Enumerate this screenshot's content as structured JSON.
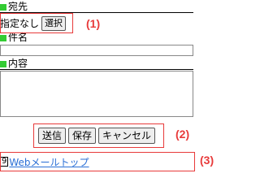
{
  "to_section": {
    "heading": "宛先",
    "value": "指定なし",
    "select_button": "選択"
  },
  "subject_section": {
    "heading": "件名",
    "value": ""
  },
  "body_section": {
    "heading": "内容",
    "value": ""
  },
  "actions": {
    "send": "送信",
    "save": "保存",
    "cancel": "キャンセル"
  },
  "footer": {
    "access_key": "9",
    "link_text": "Webメールトップ"
  },
  "callouts": {
    "c1": "(1)",
    "c2": "(2)",
    "c3": "(3)"
  },
  "colors": {
    "heading_marker": "#33cc33",
    "callout": "#e83a3a",
    "link": "#2a6fd6"
  }
}
